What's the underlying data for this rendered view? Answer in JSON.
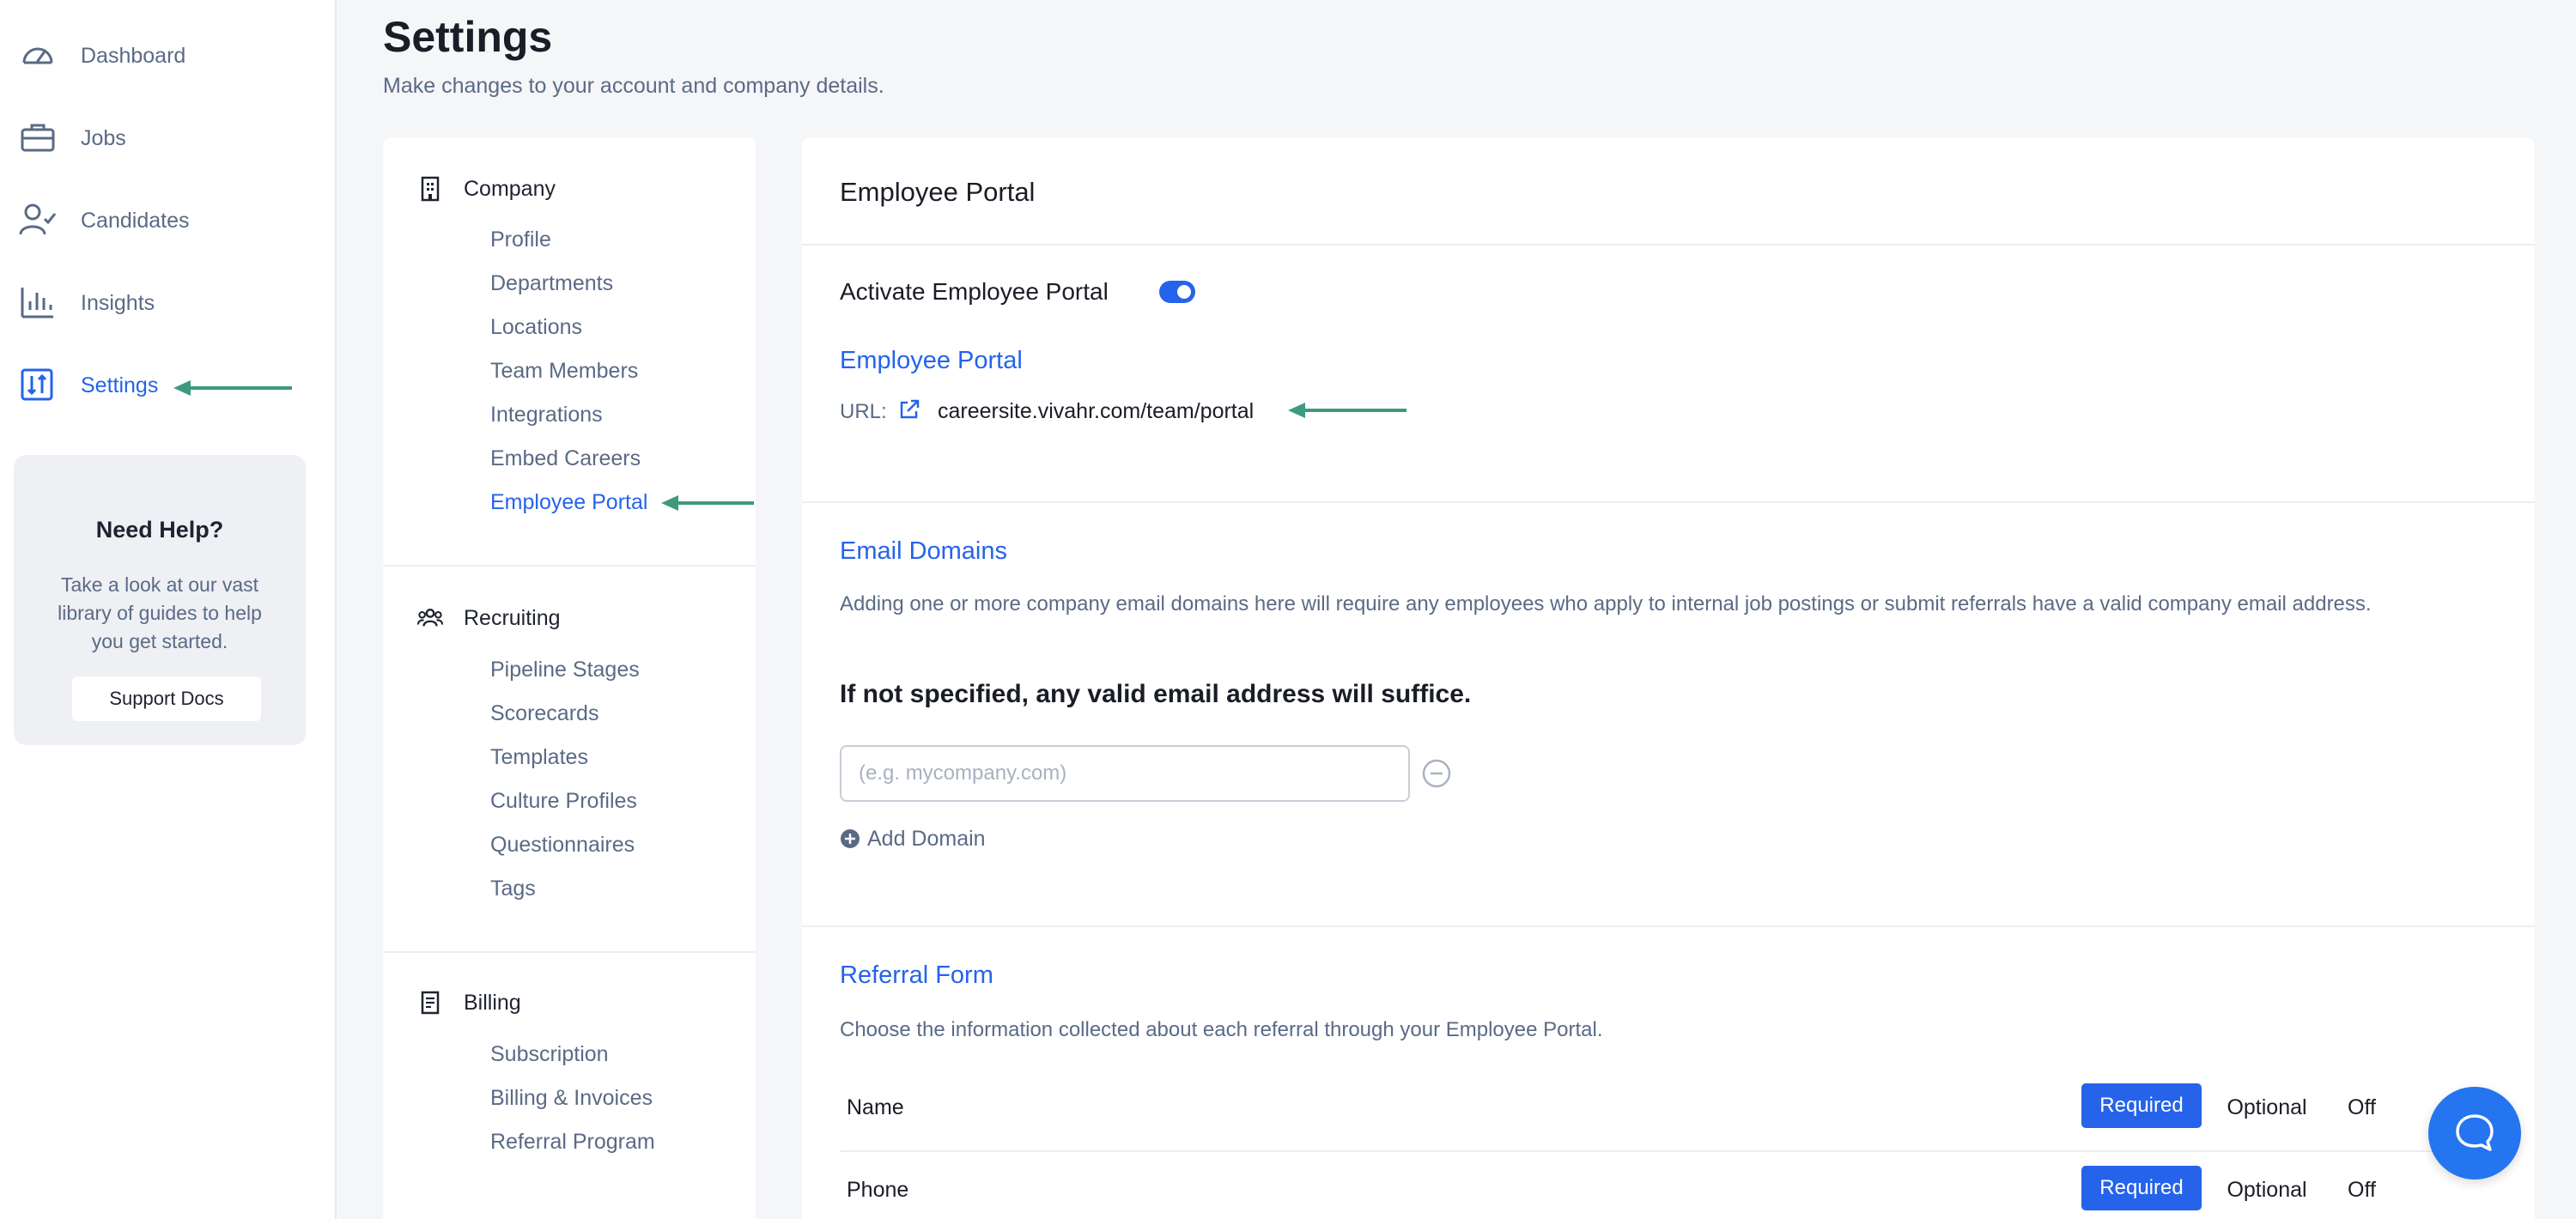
{
  "sidebar": {
    "items": [
      {
        "label": "Dashboard",
        "icon": "gauge-icon"
      },
      {
        "label": "Jobs",
        "icon": "briefcase-icon"
      },
      {
        "label": "Candidates",
        "icon": "user-check-icon"
      },
      {
        "label": "Insights",
        "icon": "bar-chart-icon"
      },
      {
        "label": "Settings",
        "icon": "settings-sliders-icon",
        "active": true
      }
    ],
    "help": {
      "title": "Need Help?",
      "text": "Take a look at our vast library of guides to help you get started.",
      "button": "Support Docs"
    }
  },
  "header": {
    "title": "Settings",
    "subtitle": "Make changes to your account and company details."
  },
  "submenu": {
    "company": {
      "label": "Company",
      "icon": "building-icon",
      "items": [
        "Profile",
        "Departments",
        "Locations",
        "Team Members",
        "Integrations",
        "Embed Careers",
        "Employee Portal"
      ]
    },
    "recruiting": {
      "label": "Recruiting",
      "icon": "users-icon",
      "items": [
        "Pipeline Stages",
        "Scorecards",
        "Templates",
        "Culture Profiles",
        "Questionnaires",
        "Tags"
      ]
    },
    "billing": {
      "label": "Billing",
      "icon": "receipt-icon",
      "items": [
        "Subscription",
        "Billing & Invoices",
        "Referral Program"
      ]
    }
  },
  "main": {
    "title": "Employee Portal",
    "activate_label": "Activate Employee Portal",
    "portal_title": "Employee Portal",
    "url_label": "URL:",
    "url_value": "careersite.vivahr.com/team/portal",
    "email_domains": {
      "title": "Email Domains",
      "description": "Adding one or more company email domains here will require any employees who apply to internal job postings or submit referrals have a valid company email address.",
      "note": "If not specified, any valid email address will suffice.",
      "input_placeholder": "(e.g. mycompany.com)",
      "input_value": "",
      "add_label": "Add Domain"
    },
    "referral_form": {
      "title": "Referral Form",
      "description": "Choose the information collected about each referral through your Employee Portal.",
      "options": {
        "required": "Required",
        "optional": "Optional",
        "off": "Off"
      },
      "rows": [
        {
          "field": "Name",
          "selected": "Required"
        },
        {
          "field": "Phone",
          "selected": "Required"
        }
      ]
    }
  },
  "colors": {
    "accent": "#2563eb",
    "arrow": "#3d9a7e",
    "chat": "#2574f0"
  }
}
